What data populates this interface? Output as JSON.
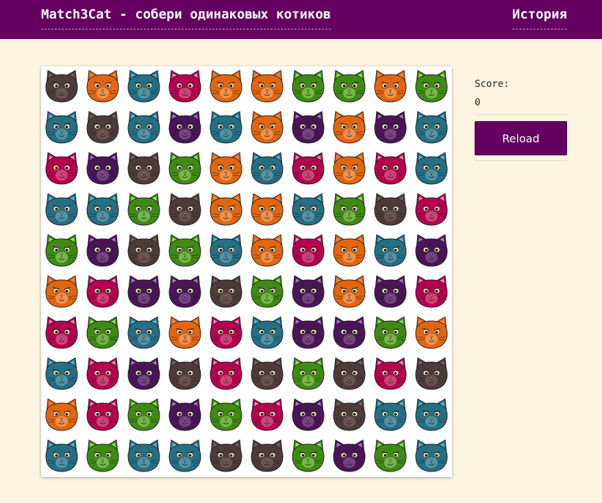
{
  "header": {
    "title": "Match3Cat - собери одинаковых котиков",
    "history_link": "История"
  },
  "sidebar": {
    "score_label": "Score:",
    "score_value": "0",
    "reload_label": "Reload"
  },
  "board": {
    "rows": 10,
    "cols": 10,
    "cat_colors": {
      "brown": {
        "body": "#4d3b3b",
        "ear": "#7a6262",
        "muzzle": "#705858"
      },
      "orange": {
        "body": "#e3650e",
        "ear": "#f08a3e",
        "muzzle": "#f29a5a"
      },
      "teal": {
        "body": "#246f84",
        "ear": "#5ab8d6",
        "muzzle": "#5b9aa9"
      },
      "pink": {
        "body": "#b8004f",
        "ear": "#f28cc0",
        "muzzle": "#d0507e"
      },
      "green": {
        "body": "#3f8a14",
        "ear": "#8ee854",
        "muzzle": "#7fbf4f"
      },
      "purple": {
        "body": "#4a1556",
        "ear": "#b56fd1",
        "muzzle": "#7d4b8a"
      }
    },
    "grid": [
      [
        "brown",
        "orange",
        "teal",
        "pink",
        "orange",
        "orange",
        "green",
        "green",
        "orange",
        "green"
      ],
      [
        "teal",
        "brown",
        "teal",
        "purple",
        "teal",
        "orange",
        "purple",
        "orange",
        "purple",
        "teal"
      ],
      [
        "pink",
        "purple",
        "brown",
        "green",
        "orange",
        "teal",
        "pink",
        "orange",
        "pink",
        "teal"
      ],
      [
        "teal",
        "teal",
        "green",
        "brown",
        "orange",
        "orange",
        "teal",
        "green",
        "brown",
        "pink"
      ],
      [
        "green",
        "purple",
        "brown",
        "green",
        "teal",
        "orange",
        "pink",
        "orange",
        "teal",
        "purple"
      ],
      [
        "orange",
        "pink",
        "purple",
        "purple",
        "brown",
        "green",
        "purple",
        "orange",
        "purple",
        "pink"
      ],
      [
        "pink",
        "green",
        "teal",
        "orange",
        "pink",
        "teal",
        "purple",
        "purple",
        "green",
        "orange"
      ],
      [
        "teal",
        "pink",
        "purple",
        "brown",
        "pink",
        "brown",
        "green",
        "brown",
        "pink",
        "brown"
      ],
      [
        "orange",
        "pink",
        "green",
        "purple",
        "green",
        "pink",
        "purple",
        "brown",
        "teal",
        "teal"
      ],
      [
        "teal",
        "green",
        "teal",
        "teal",
        "brown",
        "brown",
        "green",
        "purple",
        "green",
        "teal"
      ]
    ]
  }
}
